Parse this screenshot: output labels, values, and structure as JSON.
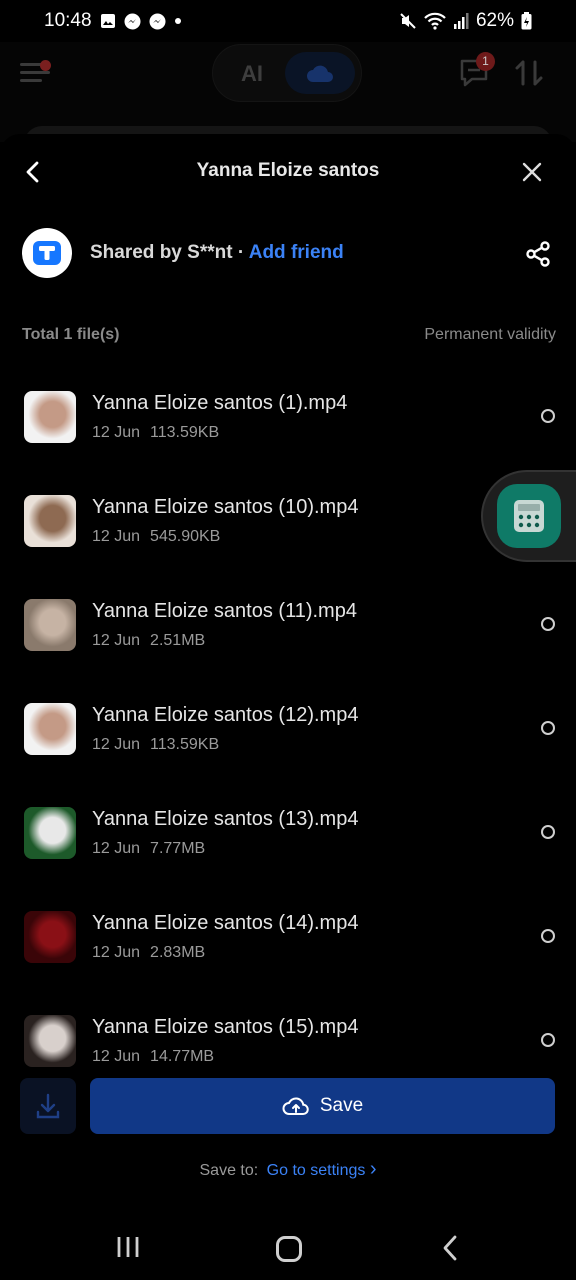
{
  "status_bar": {
    "time": "10:48",
    "notification_icons": [
      "gallery-icon",
      "messenger-icon",
      "messenger-icon"
    ],
    "battery": "62%"
  },
  "background": {
    "mode_ai_label": "AI",
    "chat_badge": "1"
  },
  "sheet": {
    "title": "Yanna Eloize santos",
    "shared_by": "Shared by S**nt",
    "separator": " · ",
    "add_friend": "Add friend",
    "total_label": "Total 1 file(s)",
    "validity": "Permanent validity"
  },
  "files": [
    {
      "name": "Yanna Eloize santos (1).mp4",
      "date": "12 Jun",
      "size": "113.59KB",
      "thumb_colors": [
        "#f2f2f2",
        "#c49a86"
      ]
    },
    {
      "name": "Yanna Eloize santos (10).mp4",
      "date": "12 Jun",
      "size": "545.90KB",
      "thumb_colors": [
        "#e9e0d8",
        "#8e6a52"
      ]
    },
    {
      "name": "Yanna Eloize santos (11).mp4",
      "date": "12 Jun",
      "size": "2.51MB",
      "thumb_colors": [
        "#8a7a6c",
        "#c6b3a4"
      ]
    },
    {
      "name": "Yanna Eloize santos (12).mp4",
      "date": "12 Jun",
      "size": "113.59KB",
      "thumb_colors": [
        "#f2f2f2",
        "#c49a86"
      ]
    },
    {
      "name": "Yanna Eloize santos (13).mp4",
      "date": "12 Jun",
      "size": "7.77MB",
      "thumb_colors": [
        "#1d5a2a",
        "#e8e8e8"
      ]
    },
    {
      "name": "Yanna Eloize santos (14).mp4",
      "date": "12 Jun",
      "size": "2.83MB",
      "thumb_colors": [
        "#3a0508",
        "#8a1016"
      ]
    },
    {
      "name": "Yanna Eloize santos (15).mp4",
      "date": "12 Jun",
      "size": "14.77MB",
      "thumb_colors": [
        "#2a2220",
        "#d8d0cc"
      ]
    }
  ],
  "bottom": {
    "save_label": "Save",
    "save_to_label": "Save to:",
    "go_to_settings": "Go to settings",
    "chevron": "›"
  },
  "colors": {
    "accent": "#3b82f6",
    "save_button": "#113887",
    "float_widget": "#0f7a67"
  }
}
